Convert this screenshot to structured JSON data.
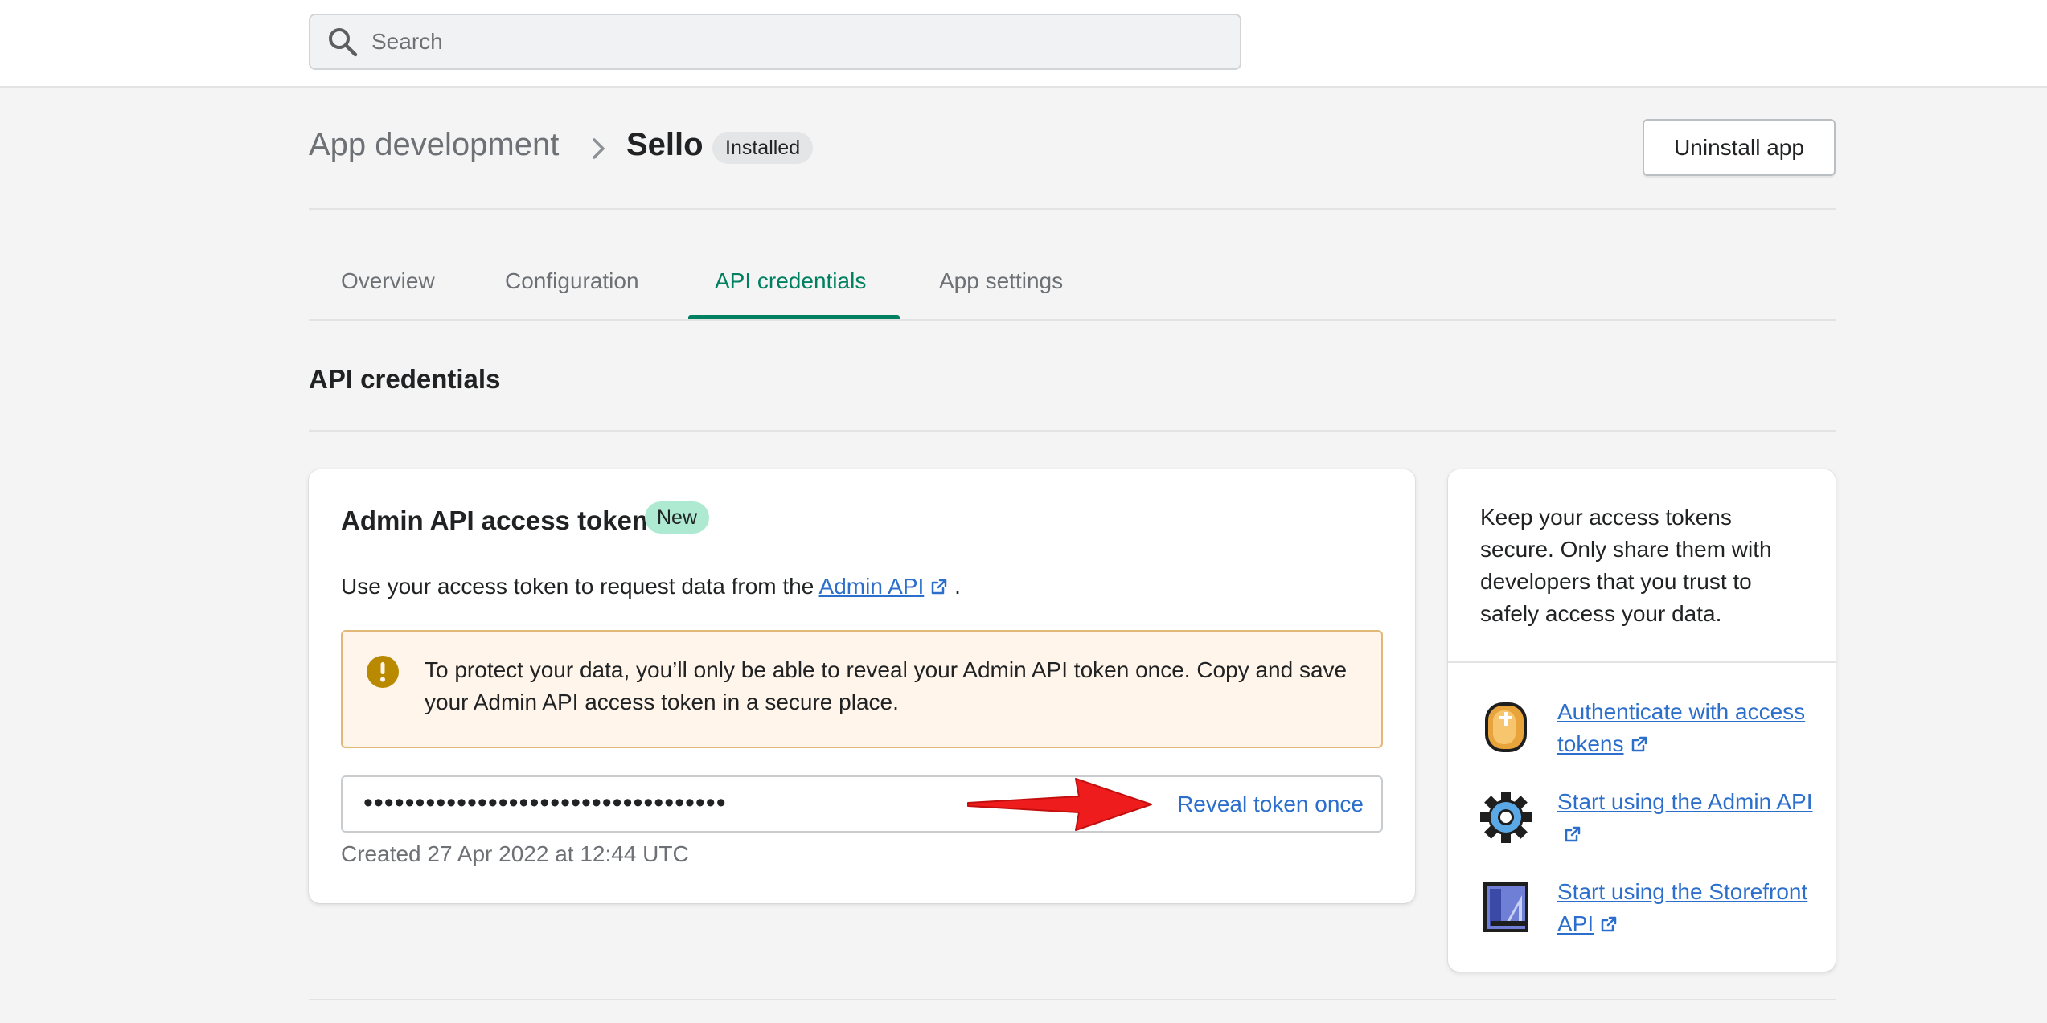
{
  "search": {
    "placeholder": "Search"
  },
  "header": {
    "breadcrumb_parent": "App development",
    "title": "Sello",
    "status_badge": "Installed",
    "uninstall_label": "Uninstall app"
  },
  "tabs": [
    {
      "label": "Overview"
    },
    {
      "label": "Configuration"
    },
    {
      "label": "API credentials",
      "active": true
    },
    {
      "label": "App settings"
    }
  ],
  "section_title": "API credentials",
  "token_card": {
    "title": "Admin API access token",
    "badge": "New",
    "intro_prefix": "Use your access token to request data from the",
    "intro_link": "Admin API",
    "intro_suffix": ".",
    "banner_text": "To protect your data, you’ll only be able to reveal your Admin API token once. Copy and save your Admin API access token in a secure place.",
    "token_masked": "•••••••••••••••••••••••••••••••••••",
    "reveal_label": "Reveal token once",
    "created": "Created 27 Apr 2022 at 12:44 UTC"
  },
  "side_card": {
    "text": "Keep your access tokens secure. Only share them with developers that you trust to safely access your data.",
    "resources": [
      {
        "label": "Authenticate with access tokens",
        "icon": "coin-icon"
      },
      {
        "label": "Start using the Admin API",
        "icon": "gear-icon"
      },
      {
        "label": "Start using the Storefront API",
        "icon": "blueprint-icon"
      }
    ]
  },
  "colors": {
    "accent": "#008060",
    "link": "#2c6ecb",
    "warning_bg": "#fff5ea",
    "new_badge": "#aee9d1",
    "annotation_arrow": "#ee1c1c"
  }
}
